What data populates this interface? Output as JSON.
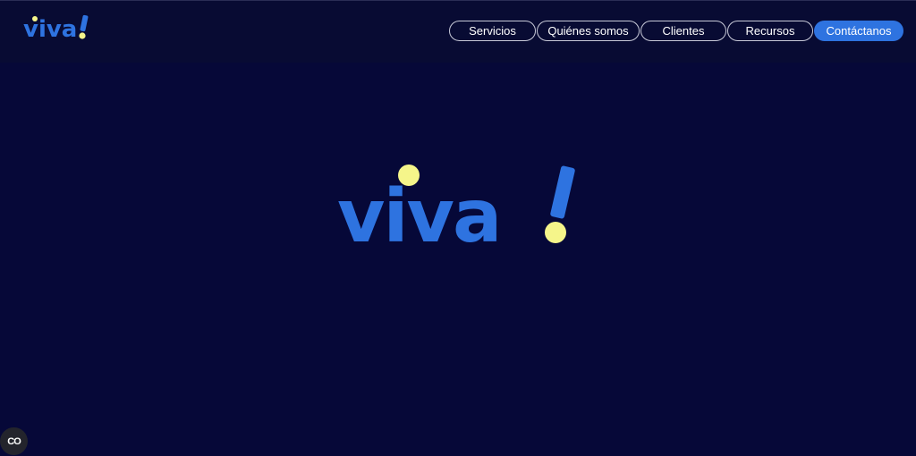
{
  "brand": {
    "logo_text": "viva!",
    "colors": {
      "blue": "#2e73e0",
      "yellow": "#f5f58a",
      "background": "#070a35"
    }
  },
  "nav": {
    "items": [
      {
        "label": "Servicios"
      },
      {
        "label": "Quiénes somos"
      },
      {
        "label": "Clientes"
      },
      {
        "label": "Recursos"
      },
      {
        "label": "Contáctanos"
      }
    ]
  },
  "widget": {
    "cc_label": "CO",
    "icon": "captions-icon"
  }
}
